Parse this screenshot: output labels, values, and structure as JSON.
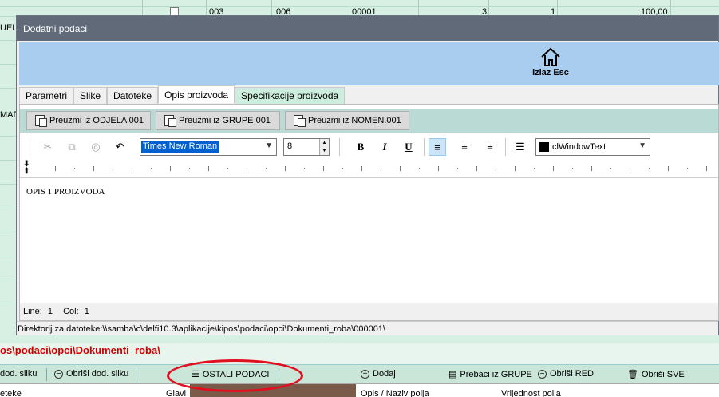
{
  "background": {
    "top_row": [
      "003",
      "006",
      "00001",
      "3",
      "1",
      "100,00"
    ],
    "left_fragments": [
      "UEL",
      "MAD"
    ],
    "path_text": "os\\podaci\\opci\\Dokumenti_roba\\",
    "toolbar": {
      "add_image_partial": "dod. sliku",
      "remove_image": "Obriši dod. sliku",
      "other_data": "OSTALI PODACI",
      "add": "Dodaj",
      "copy_group": "Prebaci iz GRUPE",
      "delete_row": "Obriši RED",
      "delete_all": "Obriši SVE"
    },
    "bottom_headers": [
      "eteke",
      "Glavi",
      "Opis / Naziv polja",
      "Vrijednost polja"
    ]
  },
  "dialog": {
    "title": "Dodatni podaci",
    "exit_label": "Izlaz Esc",
    "tabs": [
      {
        "label": "Parametri"
      },
      {
        "label": "Slike"
      },
      {
        "label": "Datoteke"
      },
      {
        "label": "Opis proizvoda"
      },
      {
        "label": "Specifikacije proizvoda"
      }
    ],
    "buttons": {
      "from_department": "Preuzmi iz ODJELA 001",
      "from_group": "Preuzmi iz GRUPE 001",
      "from_nomen": "Preuzmi iz NOMEN.001"
    },
    "formatting": {
      "font_name": "Times New Roman",
      "font_size": "8",
      "bold": "B",
      "italic": "I",
      "underline": "U",
      "color_name": "clWindowText"
    },
    "editor_text": "OPIS 1 PROIZVODA",
    "status": {
      "line_label": "Line:",
      "line": "1",
      "col_label": "Col:",
      "col": "1"
    },
    "directory": "Direktorij za datoteke:\\\\samba\\c\\delfi10.3\\aplikacije\\kipos\\podaci\\opci\\Dokumenti_roba\\000001\\"
  },
  "colors": {
    "title_bar": "#606a78",
    "banner": "#a9cdee",
    "button_bar": "#b9dad5",
    "path_red": "#d00000",
    "annotation": "#e01020",
    "selection": "#0060d0"
  }
}
